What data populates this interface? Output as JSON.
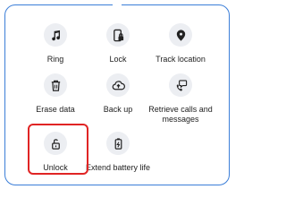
{
  "tiles": [
    {
      "label": "Ring",
      "icon": "music-note-icon"
    },
    {
      "label": "Lock",
      "icon": "phone-lock-icon"
    },
    {
      "label": "Track location",
      "icon": "location-pin-icon"
    },
    {
      "label": "Erase data",
      "icon": "trash-icon"
    },
    {
      "label": "Back up",
      "icon": "cloud-upload-icon"
    },
    {
      "label": "Retrieve calls and messages",
      "icon": "chat-phone-icon"
    },
    {
      "label": "Unlock",
      "icon": "unlock-icon"
    },
    {
      "label": "Extend battery life",
      "icon": "battery-icon"
    }
  ],
  "colors": {
    "frame_border": "#3b7ed8",
    "highlight_border": "#e02424",
    "icon_bg": "#eceef2"
  }
}
